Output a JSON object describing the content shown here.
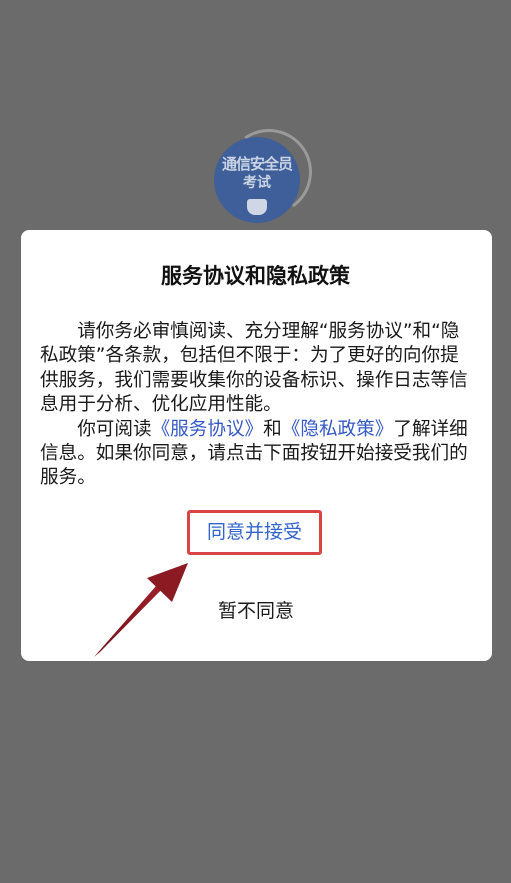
{
  "logo": {
    "line1": "通信安全员",
    "line2": "考试",
    "shield_icon": "shield-icon"
  },
  "dialog": {
    "title": "服务协议和隐私政策",
    "paragraph1": "请你务必审慎阅读、充分理解“服务协议”和“隐私政策”各条款，包括但不限于：为了更好的向你提供服务，我们需要收集你的设备标识、操作日志等信息用于分析、优化应用性能。",
    "paragraph2_prefix": "你可阅读",
    "link_service": "《服务协议》",
    "paragraph2_and": "和",
    "link_privacy": "《隐私政策》",
    "paragraph2_suffix": "了解详细信息。如果你同意，请点击下面按钮开始接受我们的服务。",
    "agree_label": "同意并接受",
    "disagree_label": "暂不同意"
  },
  "colors": {
    "overlay": "#6b6b6b",
    "link": "#3559c4",
    "agree_text": "#3366cc",
    "highlight_border": "#d94545",
    "arrow": "#8b1a22"
  }
}
